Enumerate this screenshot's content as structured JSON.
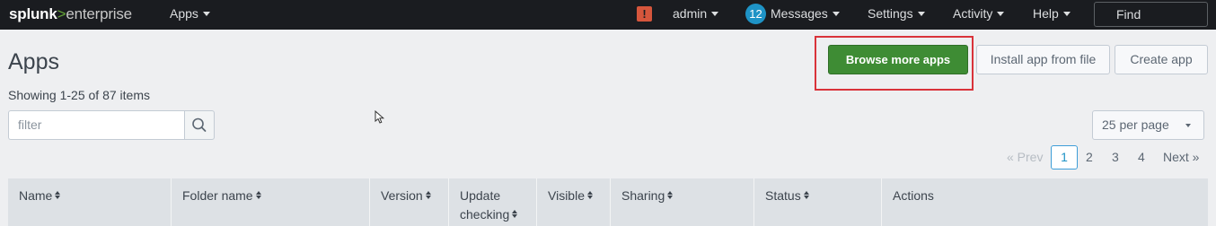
{
  "topbar": {
    "logo_brand": "splunk",
    "logo_chevron": ">",
    "logo_product": "enterprise",
    "apps_menu": "Apps",
    "user_menu": "admin",
    "messages_count": "12",
    "messages_menu": "Messages",
    "settings_menu": "Settings",
    "activity_menu": "Activity",
    "help_menu": "Help",
    "find_placeholder": "Find",
    "alert_glyph": "!"
  },
  "page": {
    "title": "Apps",
    "showing": "Showing 1-25 of 87 items",
    "browse_button": "Browse more apps",
    "install_button": "Install app from file",
    "create_button": "Create app",
    "filter_placeholder": "filter",
    "per_page": "25 per page"
  },
  "pagination": {
    "prev": "« Prev",
    "pages": [
      "1",
      "2",
      "3",
      "4"
    ],
    "active": "1",
    "next": "Next »"
  },
  "table": {
    "columns": [
      "Name",
      "Folder name",
      "Version",
      "Update checking",
      "Visible",
      "Sharing",
      "Status",
      "Actions"
    ]
  },
  "colors": {
    "primary_button": "#3e8c34",
    "highlight_box": "#d9333a",
    "logo_accent": "#65a637",
    "badge": "#1e93c6"
  }
}
